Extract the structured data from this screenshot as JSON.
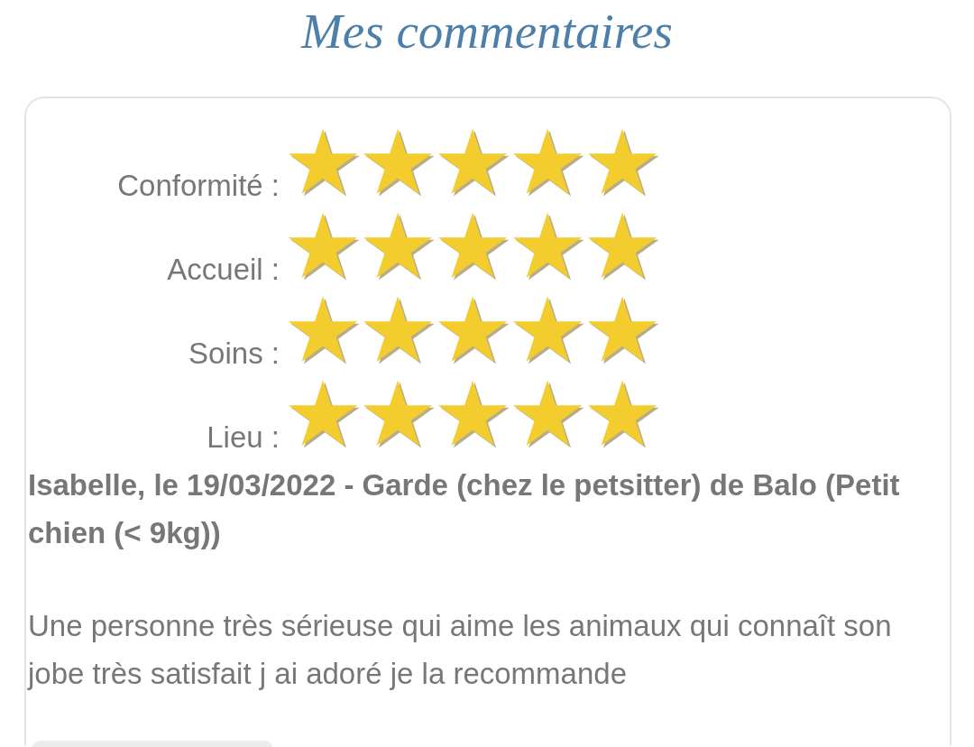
{
  "title": "Mes commentaires",
  "review": {
    "ratings": [
      {
        "label": "Conformité :",
        "stars": 5
      },
      {
        "label": "Accueil :",
        "stars": 5
      },
      {
        "label": "Soins :",
        "stars": 5
      },
      {
        "label": "Lieu :",
        "stars": 5
      }
    ],
    "heading": "Isabelle, le 19/03/2022 - Garde (chez le petsitter) de Balo (Petit chien (< 9kg))",
    "comment": "Une personne très sérieuse qui aime les animaux qui connaît son jobe très satisfait j ai adoré je la recommande"
  }
}
